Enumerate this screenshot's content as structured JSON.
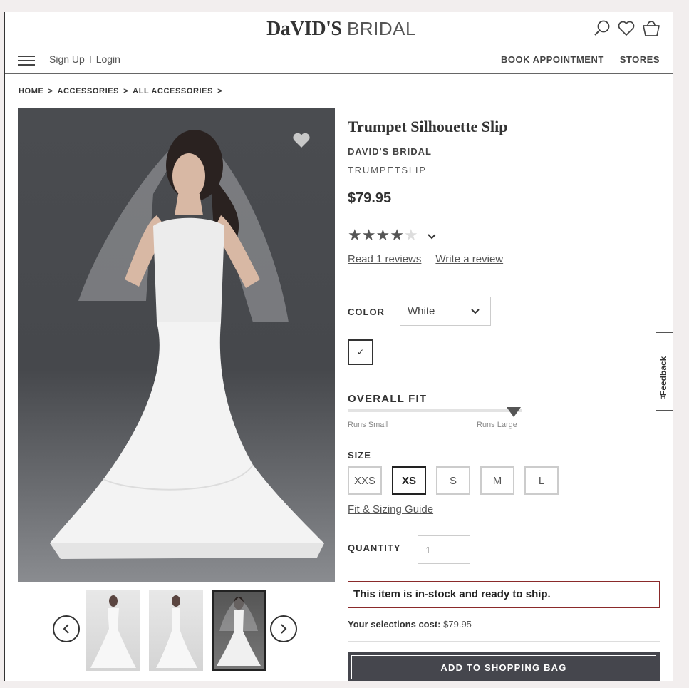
{
  "header": {
    "logo_a": "DaVID'S",
    "logo_b": "BRIDAL",
    "sign_up": "Sign Up",
    "separator": "I",
    "login": "Login",
    "nav": [
      "BOOK APPOINTMENT",
      "STORES"
    ],
    "icons": [
      "search-icon",
      "heart-icon",
      "shopping-bag-icon"
    ]
  },
  "breadcrumb": [
    "HOME",
    ">",
    "ACCESSORIES",
    ">",
    "ALL ACCESSORIES",
    ">"
  ],
  "product": {
    "title": "Trumpet Silhouette Slip",
    "brand": "DAVID'S BRIDAL",
    "sku": "TRUMPETSLIP",
    "price": "$79.95",
    "rating": 4,
    "rating_max": 5,
    "read_reviews": "Read 1 reviews",
    "write_review": "Write a review"
  },
  "color": {
    "label": "COLOR",
    "selected": "White",
    "swatch_mark": "✓"
  },
  "fit": {
    "title": "OVERALL FIT",
    "low": "Runs Small",
    "high": "Runs Large",
    "value": 0.95
  },
  "size": {
    "label": "SIZE",
    "options": [
      "XXS",
      "XS",
      "S",
      "M",
      "L"
    ],
    "selected": "XS",
    "guide": "Fit & Sizing Guide"
  },
  "quantity": {
    "label": "QUANTITY",
    "value": "1"
  },
  "stock_message": "This item is in-stock and ready to ship.",
  "cost": {
    "label": "Your selections cost:",
    "value": "$79.95"
  },
  "add_button": "ADD TO SHOPPING BAG",
  "feedback": "Feedback",
  "feedback_icon_glyph": "H"
}
